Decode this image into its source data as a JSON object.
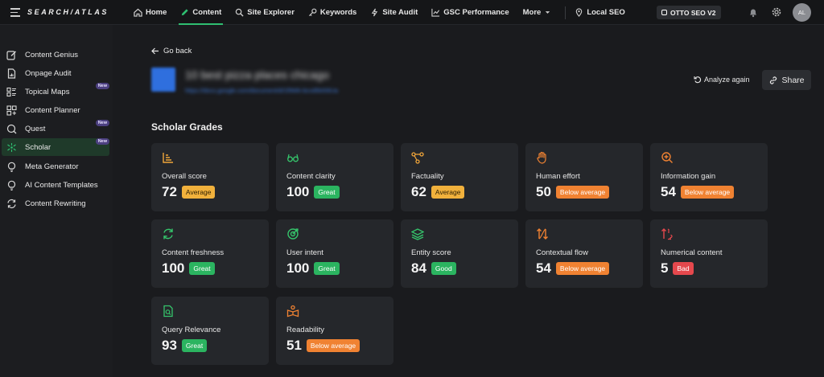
{
  "brand": {
    "logo": "SEARCH/ATLAS"
  },
  "nav": {
    "items": [
      {
        "label": "Home",
        "icon": "home-icon"
      },
      {
        "label": "Content",
        "icon": "pencil-icon",
        "active": true
      },
      {
        "label": "Site Explorer",
        "icon": "site-explorer-icon"
      },
      {
        "label": "Keywords",
        "icon": "key-icon"
      },
      {
        "label": "Site Audit",
        "icon": "site-audit-icon"
      },
      {
        "label": "GSC Performance",
        "icon": "chart-icon"
      },
      {
        "label": "More",
        "icon": "chevron-down-icon"
      },
      {
        "label": "Local SEO",
        "icon": "map-pin-icon"
      }
    ],
    "otto_label": "OTTO SEO V2",
    "avatar_initials": "AL"
  },
  "sidebar": {
    "items": [
      {
        "label": "Content Genius",
        "badge": ""
      },
      {
        "label": "Onpage Audit",
        "badge": ""
      },
      {
        "label": "Topical Maps",
        "badge": "New"
      },
      {
        "label": "Content Planner",
        "badge": ""
      },
      {
        "label": "Quest",
        "badge": "New"
      },
      {
        "label": "Scholar",
        "badge": "New",
        "active": true
      },
      {
        "label": "Meta Generator",
        "badge": ""
      },
      {
        "label": "AI Content Templates",
        "badge": ""
      },
      {
        "label": "Content Rewriting",
        "badge": ""
      }
    ]
  },
  "main": {
    "go_back": "Go back",
    "doc_title": "10 best pizza places chicago",
    "doc_url": "https://docs.google.com/document/d/1f9Wk-bcvd5kI06Ua",
    "analyze_label": "Analyze again",
    "share_label": "Share",
    "section_title": "Scholar Grades",
    "cards": [
      {
        "label": "Overall score",
        "value": "72",
        "grade": "Average",
        "grade_type": "avg",
        "icon": "bar-chart-icon",
        "icon_color": "#f0a53a"
      },
      {
        "label": "Content clarity",
        "value": "100",
        "grade": "Great",
        "grade_type": "great",
        "icon": "glasses-icon",
        "icon_color": "#35c46b"
      },
      {
        "label": "Factuality",
        "value": "62",
        "grade": "Average",
        "grade_type": "avg",
        "icon": "nodes-icon",
        "icon_color": "#f0a53a"
      },
      {
        "label": "Human effort",
        "value": "50",
        "grade": "Below average",
        "grade_type": "below",
        "icon": "hand-icon",
        "icon_color": "#f08232"
      },
      {
        "label": "Information gain",
        "value": "54",
        "grade": "Below average",
        "grade_type": "below",
        "icon": "zoom-in-icon",
        "icon_color": "#f08232"
      },
      {
        "label": "Content freshness",
        "value": "100",
        "grade": "Great",
        "grade_type": "great",
        "icon": "refresh-icon",
        "icon_color": "#35c46b"
      },
      {
        "label": "User intent",
        "value": "100",
        "grade": "Great",
        "grade_type": "great",
        "icon": "target-icon",
        "icon_color": "#35c46b"
      },
      {
        "label": "Entity score",
        "value": "84",
        "grade": "Good",
        "grade_type": "good",
        "icon": "layers-icon",
        "icon_color": "#35c46b"
      },
      {
        "label": "Contextual flow",
        "value": "54",
        "grade": "Below average",
        "grade_type": "below",
        "icon": "arrows-updown-icon",
        "icon_color": "#f08232"
      },
      {
        "label": "Numerical content",
        "value": "5",
        "grade": "Bad",
        "grade_type": "bad",
        "icon": "sort-numeric-icon",
        "icon_color": "#e5484d"
      },
      {
        "label": "Query Relevance",
        "value": "93",
        "grade": "Great",
        "grade_type": "great",
        "icon": "file-search-icon",
        "icon_color": "#35c46b"
      },
      {
        "label": "Readability",
        "value": "51",
        "grade": "Below average",
        "grade_type": "below",
        "icon": "reader-icon",
        "icon_color": "#f08232"
      }
    ]
  }
}
